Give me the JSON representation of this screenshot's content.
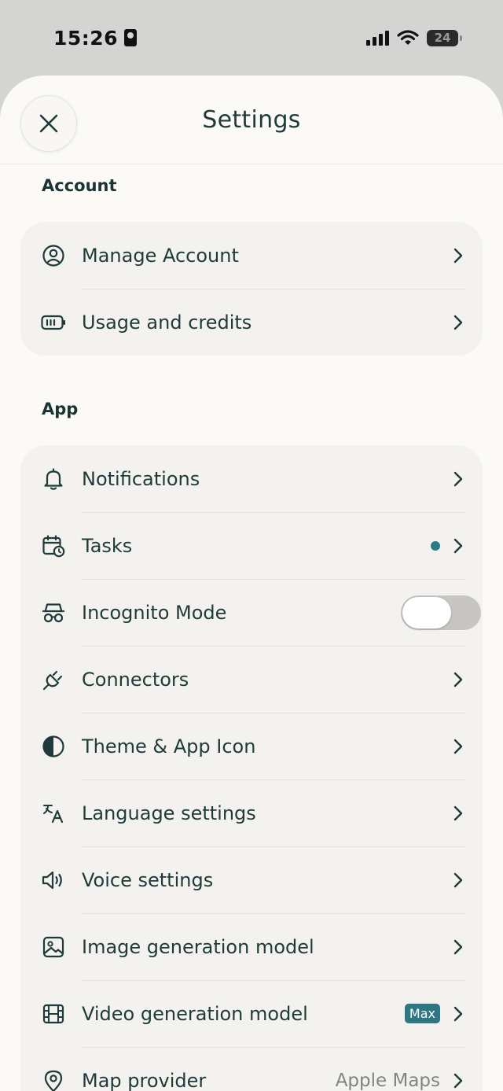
{
  "status_bar": {
    "time": "15:26",
    "battery_level": "24"
  },
  "header": {
    "title": "Settings"
  },
  "sections": {
    "account": {
      "title": "Account",
      "items": [
        {
          "label": "Manage Account",
          "icon": "user-circle-icon"
        },
        {
          "label": "Usage and credits",
          "icon": "battery-icon"
        }
      ]
    },
    "app": {
      "title": "App",
      "items": [
        {
          "label": "Notifications",
          "icon": "bell-icon"
        },
        {
          "label": "Tasks",
          "icon": "calendar-clock-icon",
          "indicator": "dot"
        },
        {
          "label": "Incognito Mode",
          "icon": "incognito-icon",
          "toggle_on": false
        },
        {
          "label": "Connectors",
          "icon": "plug-icon"
        },
        {
          "label": "Theme & App Icon",
          "icon": "contrast-icon"
        },
        {
          "label": "Language settings",
          "icon": "translate-icon"
        },
        {
          "label": "Voice settings",
          "icon": "speaker-icon"
        },
        {
          "label": "Image generation model",
          "icon": "image-icon"
        },
        {
          "label": "Video generation model",
          "icon": "film-icon",
          "badge": "Max"
        },
        {
          "label": "Map provider",
          "icon": "map-pin-icon",
          "value": "Apple Maps"
        }
      ]
    }
  },
  "colors": {
    "accent": "#2f7683",
    "text": "#1f3a3a",
    "sheet_bg": "#fbfaf7",
    "group_bg": "#f3f2ee"
  }
}
